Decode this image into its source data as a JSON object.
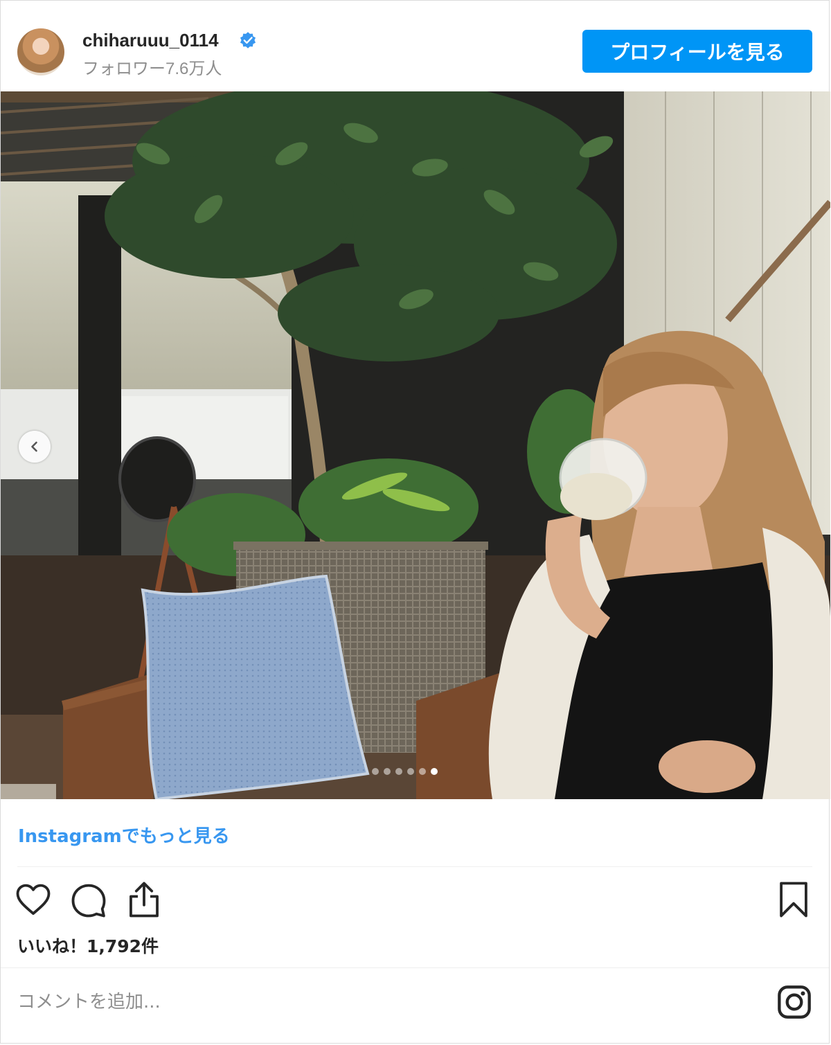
{
  "header": {
    "username": "chiharuuu_0114",
    "followers": "フォロワー7.6万人",
    "profile_button": "プロフィールを見る"
  },
  "media": {
    "carousel": {
      "slide_count": 6,
      "active_slide": 6
    }
  },
  "links": {
    "more_on_instagram": "Instagramでもっと見る"
  },
  "actions": {
    "likes_text": "いいね！1,792件"
  },
  "comment": {
    "placeholder": "コメントを追加..."
  },
  "colors": {
    "primary_button": "#0095f6",
    "link": "#3897f0",
    "verified_badge": "#3897f0"
  },
  "icons": [
    "verified-badge-icon",
    "chevron-left-icon",
    "heart-icon",
    "comment-icon",
    "share-icon",
    "bookmark-icon",
    "instagram-logo-icon"
  ]
}
